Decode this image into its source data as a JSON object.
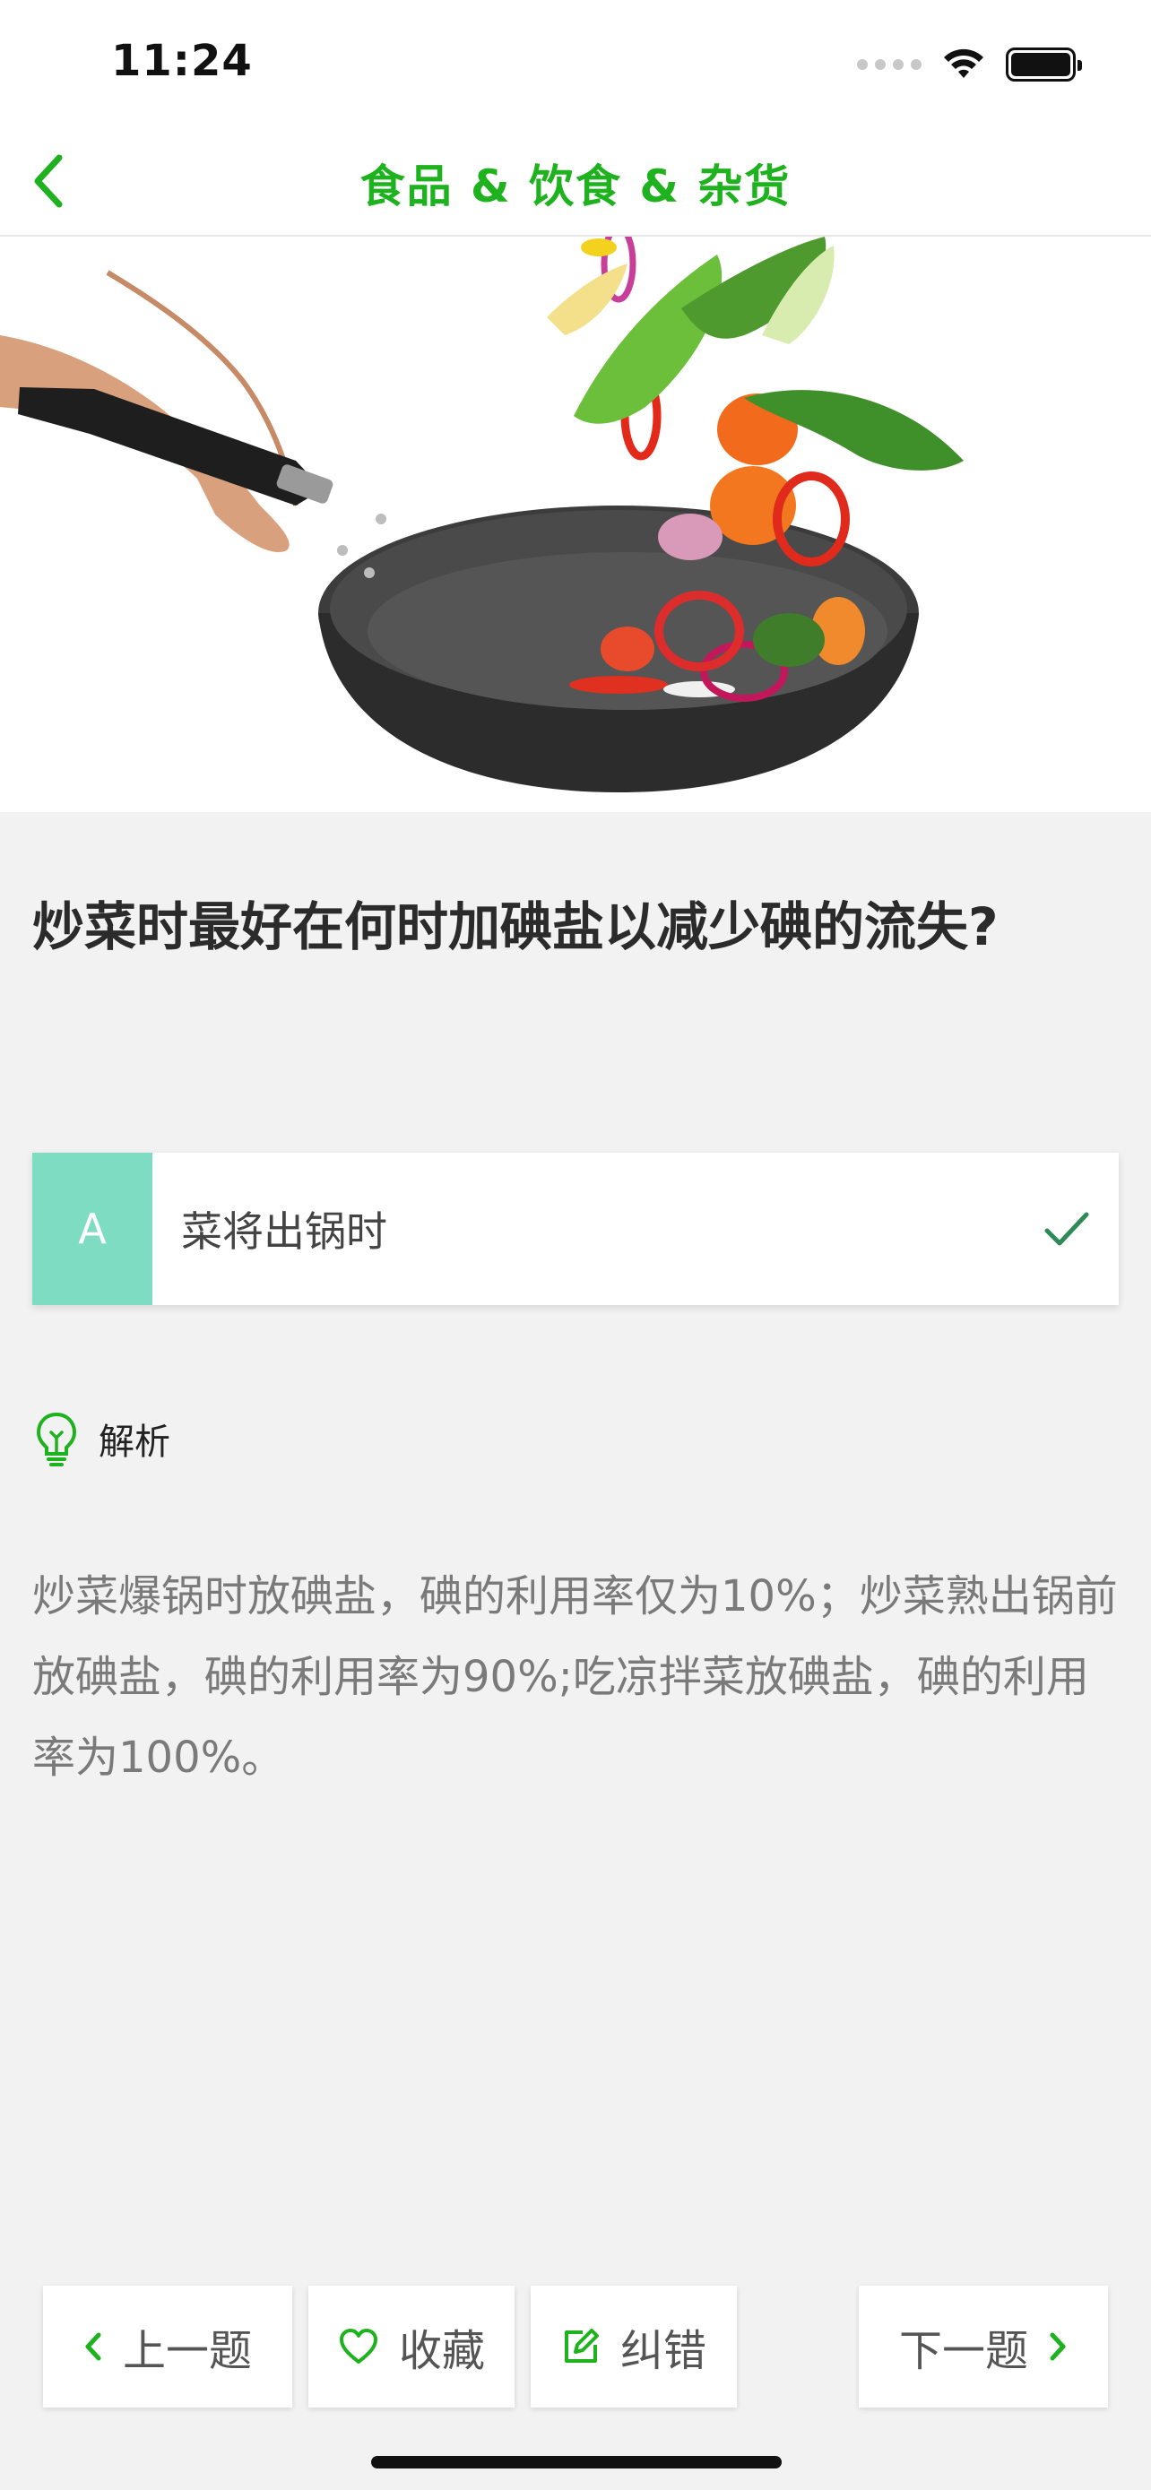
{
  "status_bar": {
    "time": "11:24"
  },
  "nav": {
    "title": "食品 & 饮食 & 杂货",
    "back_icon": "chevron-left-icon"
  },
  "hero": {
    "image": "stir-fry-wok-vegetables"
  },
  "question": {
    "text": "炒菜时最好在何时加碘盐以减少碘的流失?"
  },
  "option": {
    "letter": "A",
    "text": "菜将出锅时",
    "status_icon": "checkmark-icon",
    "is_correct": true
  },
  "analysis": {
    "label": "解析",
    "icon": "lightbulb-icon",
    "text": "炒菜爆锅时放碘盐，碘的利用率仅为10%；炒菜熟出锅前放碘盐，碘的利用率为90%;吃凉拌菜放碘盐，碘的利用率为100%。"
  },
  "bottom_bar": {
    "prev_label": "上一题",
    "favorite_label": "收藏",
    "correct_label": "纠错",
    "next_label": "下一题"
  },
  "colors": {
    "accent": "#1fb21f",
    "option_badge": "#7ddcc2",
    "background": "#f2f2f2",
    "check": "#2e8b57"
  }
}
